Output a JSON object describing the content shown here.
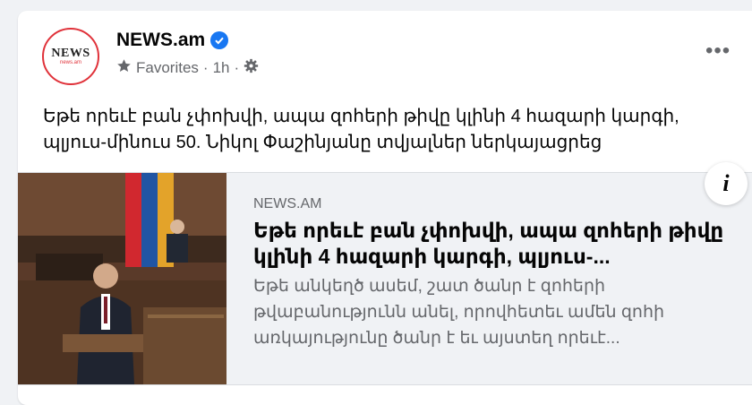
{
  "post": {
    "page_name": "NEWS.am",
    "avatar_text": "NEWS",
    "avatar_subtext": "news.am",
    "meta": {
      "favorites_label": "Favorites",
      "separator": "·",
      "time": "1h"
    },
    "text": "Եթե որեւէ բան չփոխվի, ապա զոհերի թիվը կլինի 4 հազարի կարգի, պլյուս-մինուս 50. Նիկոլ Փաշինյանը տվյալներ ներկայացրեց",
    "more_label": "•••"
  },
  "link_preview": {
    "domain": "NEWS.AM",
    "headline": "Եթե որեւէ բան չփոխվի, ապա զոհերի թիվը կլինի 4 հազարի կարգի, պլյուս-...",
    "description": "Եթե անկեղծ ասեմ, շատ ծանր է զոհերի թվաբանությունն անել, որովհետեւ ամեն զոհի առկայությունը ծանր է եւ այստեղ որեւէ...",
    "info_label": "i"
  },
  "icons": {
    "verified": "verified-badge-icon",
    "favorites": "star-icon",
    "privacy": "gear-icon",
    "more": "more-options-icon",
    "info": "info-icon"
  },
  "colors": {
    "accent": "#1877f2",
    "brand_red": "#e0323a",
    "secondary_text": "#65676b"
  }
}
